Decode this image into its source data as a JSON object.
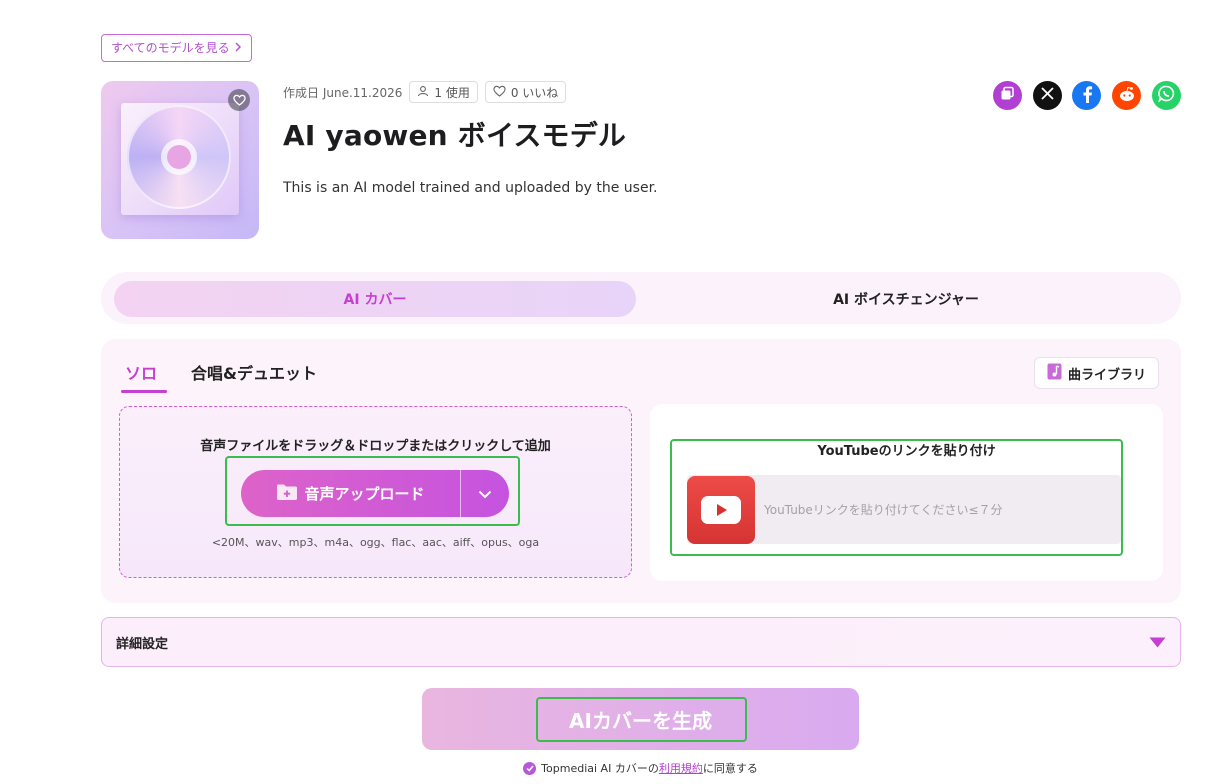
{
  "header": {
    "back_link": "すべてのモデルを見る",
    "created_label": "作成日 June.11.2026",
    "uses": "1 使用",
    "likes": "0 いいね",
    "title": "AI yaowen ボイスモデル",
    "description": "This is an AI model trained and uploaded by the user."
  },
  "share": {
    "copy_color": "#b13fd2",
    "x_color": "#111111",
    "facebook_color": "#1877f2",
    "reddit_color": "#ff4500",
    "whatsapp_color": "#25d366"
  },
  "mode_tabs": {
    "cover": "AI カバー",
    "changer": "AI ボイスチェンジャー"
  },
  "sub_tabs": {
    "solo": "ソロ",
    "duet": "合唱&デュエット"
  },
  "library_button": "曲ライブラリ",
  "upload": {
    "title": "音声ファイルをドラッグ＆ドロップまたはクリックして追加",
    "button": "音声アップロード",
    "formats": "<20M、wav、mp3、m4a、ogg、flac、aac、aiff、opus、oga"
  },
  "youtube": {
    "title": "YouTubeのリンクを貼り付け",
    "placeholder": "YouTubeリンクを貼り付けてください≤７分"
  },
  "advanced": {
    "label": "詳細設定"
  },
  "generate_button": "AIカバーを生成",
  "terms": {
    "prefix": "Topmediai AI カバーの",
    "link": "利用規約",
    "suffix": "に同意する"
  },
  "colors": {
    "accent": "#c53fd0",
    "highlight": "#3bbd4e"
  }
}
